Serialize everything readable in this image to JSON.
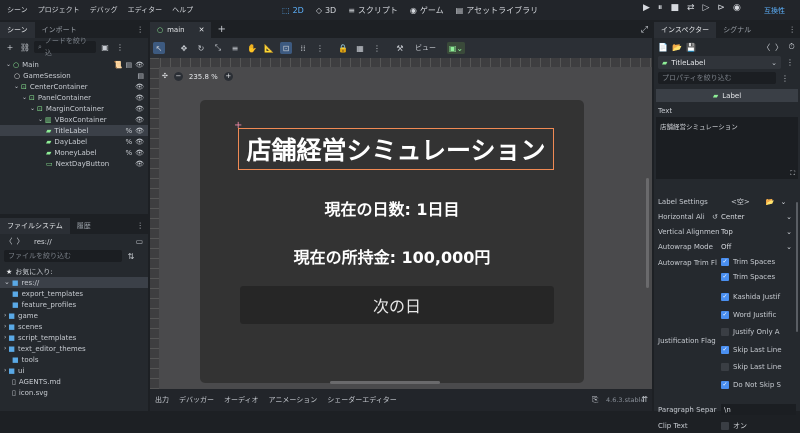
{
  "menubar": {
    "items": [
      "シーン",
      "プロジェクト",
      "デバッグ",
      "エディター",
      "ヘルプ"
    ],
    "workspaces": [
      {
        "label": "2D",
        "icon": "2d-icon",
        "active": true
      },
      {
        "label": "3D",
        "icon": "3d-icon",
        "active": false
      },
      {
        "label": "スクリプト",
        "icon": "script-icon",
        "active": false
      },
      {
        "label": "ゲーム",
        "icon": "game-icon",
        "active": false
      },
      {
        "label": "アセットライブラリ",
        "icon": "asset-library-icon",
        "active": false
      }
    ],
    "renderer": "互換性"
  },
  "scene_dock": {
    "tabs": [
      "シーン",
      "インポート"
    ],
    "filter_placeholder": "ノードを絞り込",
    "nodes": [
      {
        "name": "Main",
        "type": "node-icon",
        "color": "#8eef97"
      },
      {
        "name": "GameSession",
        "type": "node-icon",
        "color": "#e0e0e0"
      },
      {
        "name": "CenterContainer",
        "type": "container-icon",
        "color": "#8eef97"
      },
      {
        "name": "PanelContainer",
        "type": "container-icon",
        "color": "#8eef97"
      },
      {
        "name": "MarginContainer",
        "type": "container-icon",
        "color": "#8eef97"
      },
      {
        "name": "VBoxContainer",
        "type": "vbox-icon",
        "color": "#8eef97"
      },
      {
        "name": "TitleLabel",
        "type": "label-icon",
        "color": "#8eef97"
      },
      {
        "name": "DayLabel",
        "type": "label-icon",
        "color": "#8eef97"
      },
      {
        "name": "MoneyLabel",
        "type": "label-icon",
        "color": "#8eef97"
      },
      {
        "name": "NextDayButton",
        "type": "button-icon",
        "color": "#8eef97"
      }
    ]
  },
  "filesystem": {
    "tabs": [
      "ファイルシステム",
      "履歴"
    ],
    "path": "res://",
    "filter_placeholder": "ファイルを絞り込む",
    "favorites": "お気に入り:",
    "root": "res://",
    "entries": [
      {
        "name": "export_templates",
        "kind": "folder"
      },
      {
        "name": "feature_profiles",
        "kind": "folder"
      },
      {
        "name": "game",
        "kind": "folder"
      },
      {
        "name": "scenes",
        "kind": "folder"
      },
      {
        "name": "script_templates",
        "kind": "folder"
      },
      {
        "name": "text_editor_themes",
        "kind": "folder"
      },
      {
        "name": "tools",
        "kind": "folder"
      },
      {
        "name": "ui",
        "kind": "folder"
      },
      {
        "name": "AGENTS.md",
        "kind": "file"
      },
      {
        "name": "icon.svg",
        "kind": "file"
      }
    ]
  },
  "editor": {
    "tab_label": "main",
    "view_label": "ビュー",
    "zoom": "235.8 %",
    "title_text": "店舗経営シミュレーション",
    "day_text": "現在の日数: 1日目",
    "money_text": "現在の所持金: 100,000円",
    "button_text": "次の日"
  },
  "bottom_panel": {
    "tabs": [
      "出力",
      "デバッガー",
      "オーディオ",
      "アニメーション",
      "シェーダーエディター"
    ],
    "version": "4.6.3.stable"
  },
  "inspector": {
    "tabs": [
      "インスペクター",
      "シグナル"
    ],
    "node_name": "TitleLabel",
    "filter_placeholder": "プロパティを絞り込む",
    "class_name": "Label",
    "text_label": "Text",
    "text_value": "店舗経営シミュレーション",
    "label_settings": {
      "label": "Label Settings",
      "value": "<空>"
    },
    "horizontal_alignment": {
      "label": "Horizontal Ali",
      "value": "Center"
    },
    "vertical_alignment": {
      "label": "Vertical Alignmen",
      "value": "Top"
    },
    "autowrap_mode": {
      "label": "Autowrap Mode",
      "value": "Off"
    },
    "autowrap_trim": {
      "label": "Autowrap Trim Fl",
      "options": [
        {
          "label": "Trim Spaces",
          "checked": true
        },
        {
          "label": "Trim Spaces",
          "checked": true
        }
      ]
    },
    "justification": {
      "label": "Justification Flag",
      "options": [
        {
          "label": "Kashida Justif",
          "checked": true
        },
        {
          "label": "Word Justific",
          "checked": true
        },
        {
          "label": "Justify Only A",
          "checked": false
        },
        {
          "label": "Skip Last Line",
          "checked": true
        },
        {
          "label": "Skip Last Line",
          "checked": false
        },
        {
          "label": "Do Not Skip S",
          "checked": true
        }
      ]
    },
    "paragraph_separator": {
      "label": "Paragraph Separ",
      "value": "\\n"
    },
    "clip_text": {
      "label": "Clip Text",
      "value": "オン"
    }
  }
}
